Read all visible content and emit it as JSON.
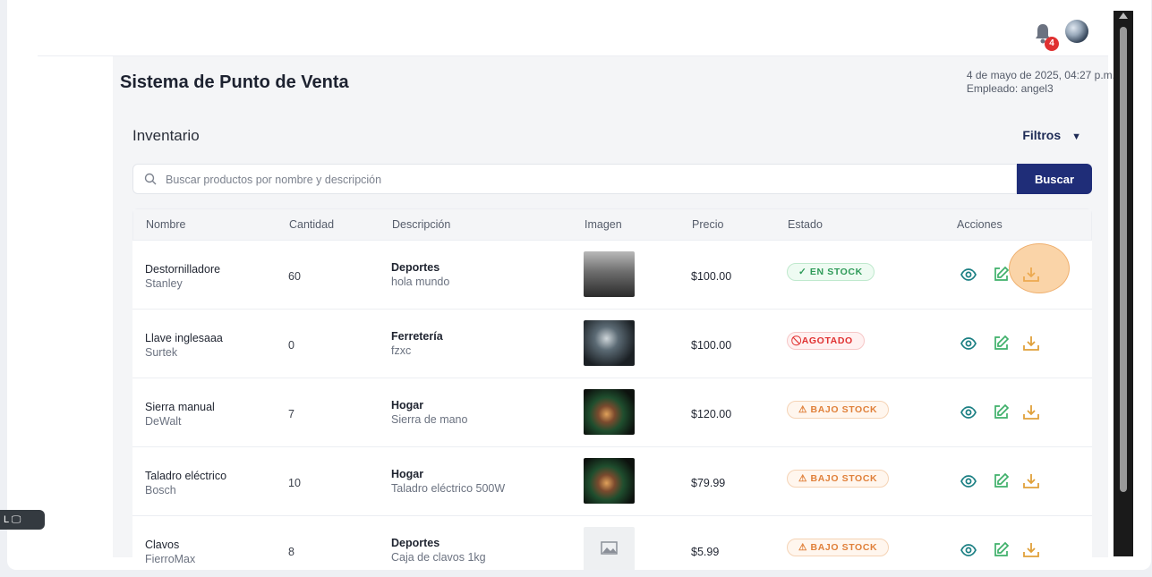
{
  "header": {
    "notification_count": "4"
  },
  "app": {
    "title": "Sistema de Punto de Venta",
    "datetime": "4 de mayo de 2025, 04:27 p.m.",
    "employee": "Empleado: angel3"
  },
  "inventory": {
    "title": "Inventario",
    "filters_label": "Filtros",
    "search_placeholder": "Buscar productos por nombre y descripción",
    "search_button": "Buscar",
    "columns": [
      "Nombre",
      "Cantidad",
      "Descripción",
      "Imagen",
      "Precio",
      "Estado",
      "Acciones"
    ],
    "rows": [
      {
        "name": "Destornilladore",
        "brand": "Stanley",
        "qty": "60",
        "category": "Deportes",
        "desc": "hola mundo",
        "price": "$100.00",
        "status": "✓ EN STOCK"
      },
      {
        "name": "Llave inglesaaa",
        "brand": "Surtek",
        "qty": "0",
        "category": "Ferretería",
        "desc": "fzxc",
        "price": "$100.00",
        "status": "⃠ AGOTADO"
      },
      {
        "name": "Sierra manual",
        "brand": "DeWalt",
        "qty": "7",
        "category": "Hogar",
        "desc": "Sierra de mano",
        "price": "$120.00",
        "status": "⚠ BAJO STOCK"
      },
      {
        "name": "Taladro eléctrico",
        "brand": "Bosch",
        "qty": "10",
        "category": "Hogar",
        "desc": "Taladro eléctrico 500W",
        "price": "$79.99",
        "status": "⚠ BAJO STOCK"
      },
      {
        "name": "Clavos",
        "brand": "FierroMax",
        "qty": "8",
        "category": "Deportes",
        "desc": "Caja de clavos 1kg",
        "price": "$5.99",
        "status": "⚠ BAJO STOCK"
      }
    ]
  },
  "overlay": {
    "badge_label": "L 🖵"
  },
  "colors": {
    "primary": "#1f2d78",
    "in_stock": "#2e9a58",
    "out_of_stock": "#e03131",
    "low_stock": "#e0803a"
  }
}
